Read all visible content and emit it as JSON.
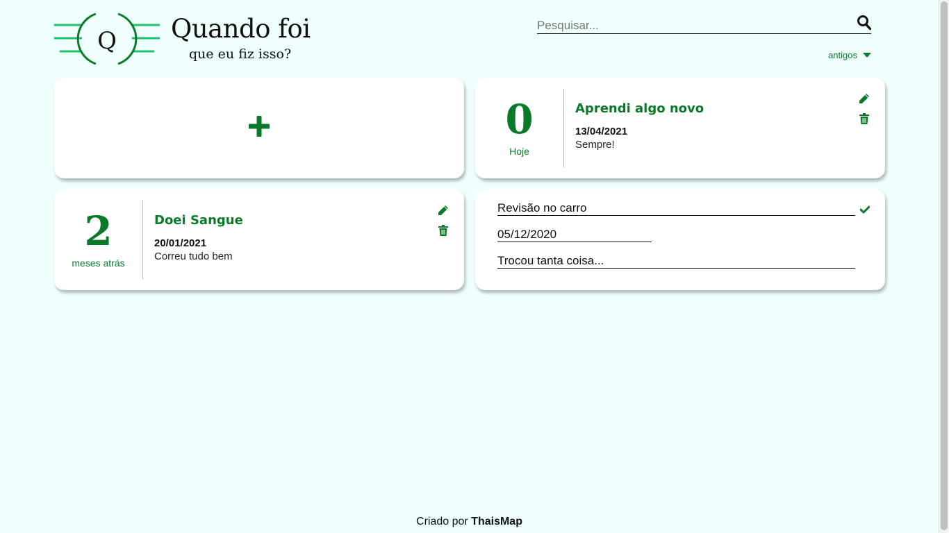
{
  "header": {
    "logo_letter": "Q",
    "title": "Quando foi",
    "subtitle": "que eu fiz isso?",
    "search_placeholder": "Pesquisar...",
    "sort_label": "antigos"
  },
  "colors": {
    "accent": "#0a7a2a",
    "logo_lines": "#1fc26a",
    "background": "#effffd"
  },
  "cards": [
    {
      "count": "0",
      "unit": "Hoje",
      "title": "Aprendi algo novo",
      "date": "13/04/2021",
      "note": "Sempre!"
    },
    {
      "count": "2",
      "unit": "meses atrás",
      "title": "Doei Sangue",
      "date": "20/01/2021",
      "note": "Correu tudo bem"
    }
  ],
  "edit_form": {
    "title_value": "Revisão no carro",
    "date_value": "05/12/2020",
    "note_value": "Trocou tanta coisa..."
  },
  "footer": {
    "prefix": "Criado por",
    "author": "ThaisMap"
  }
}
